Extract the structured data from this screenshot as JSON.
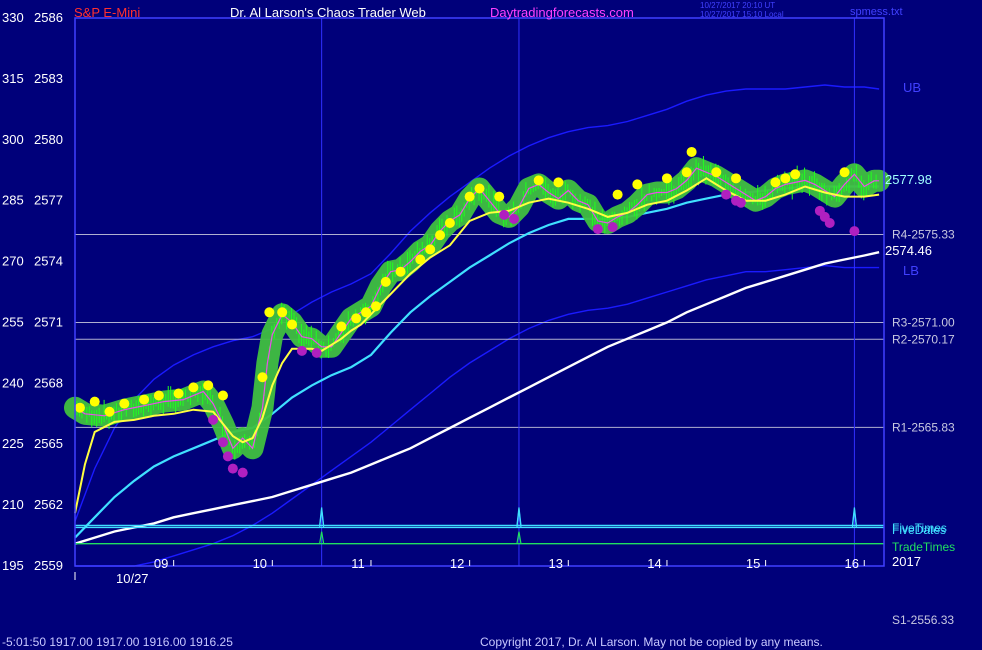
{
  "header": {
    "symbol": "S&P E-Mini",
    "title": "Dr. Al Larson's Chaos Trader Web",
    "site": "Daytradingforecasts.com",
    "stamp_utc": "10/27/2017 20:10 UT",
    "stamp_local": "10/27/2017 15:10 Local",
    "file_name": "spmess.txt"
  },
  "footer": {
    "readout": "-5:01:50  1917.00  1917.00  1916.00  1916.25",
    "copyright": "Copyright 2017, Dr. Al Larson. May not be copied by any means."
  },
  "colors": {
    "background": "#00007a",
    "frame": "#4040ff",
    "price_bars": "#20ff20",
    "fast_avg": "#ffff40",
    "mid_avg": "#40e0ff",
    "slow_avg": "#ffffff",
    "bands": "#1a1aff",
    "pivot_lines": "#b0b0d0",
    "highlight_halo": "#40c040",
    "up_marker": "#ffff00",
    "down_marker": "#b020c0"
  },
  "chart_data": {
    "type": "line",
    "y_left_ticks": [
      "330",
      "315",
      "300",
      "285",
      "270",
      "255",
      "240",
      "225",
      "210",
      "195"
    ],
    "y_price_ticks": [
      "2586",
      "2583",
      "2580",
      "2577",
      "2574",
      "2571",
      "2568",
      "2565",
      "2562",
      "2559"
    ],
    "ylim": [
      2559,
      2586
    ],
    "xlim": [
      8.0,
      16.2
    ],
    "x_ticks": [
      "09",
      "10",
      "11",
      "12",
      "13",
      "14",
      "15",
      "16"
    ],
    "date_label": "10/27",
    "vertical_markers": [
      10.5,
      12.5,
      15.9
    ],
    "pivots": [
      {
        "label": "R4-2575.33",
        "value": 2575.33
      },
      {
        "label": "R3-2571.00",
        "value": 2571.0
      },
      {
        "label": "R2-2570.17",
        "value": 2570.17
      },
      {
        "label": "R1-2565.83",
        "value": 2565.83
      },
      {
        "label": "S1-2556.33",
        "value": 2556.33
      }
    ],
    "last_price_label": "2577.98",
    "last_price": 2577.98,
    "slow_avg_label": "2574.46",
    "slow_avg_last": 2574.46,
    "band_labels": {
      "upper": "UB",
      "lower": "LB"
    },
    "time_rows": [
      {
        "name": "TradeTimes",
        "value": 2560.1,
        "label": "TradeTimes"
      },
      {
        "name": "FiveDates",
        "value": 2560.9,
        "label": "FiveDates"
      },
      {
        "name": "FiveTimes",
        "value": 2561.0,
        "label": "FiveTimes"
      }
    ],
    "year_label": "2017",
    "series": [
      {
        "name": "price",
        "x": [
          8.0,
          8.1,
          8.3,
          8.5,
          8.7,
          8.9,
          9.1,
          9.3,
          9.4,
          9.5,
          9.6,
          9.7,
          9.8,
          9.9,
          9.95,
          10.0,
          10.1,
          10.2,
          10.3,
          10.4,
          10.5,
          10.6,
          10.7,
          10.8,
          10.9,
          11.0,
          11.1,
          11.2,
          11.3,
          11.4,
          11.5,
          11.6,
          11.7,
          11.8,
          11.9,
          12.0,
          12.1,
          12.2,
          12.3,
          12.4,
          12.5,
          12.6,
          12.7,
          12.8,
          12.9,
          13.0,
          13.1,
          13.2,
          13.3,
          13.4,
          13.5,
          13.6,
          13.7,
          13.8,
          13.9,
          14.0,
          14.1,
          14.2,
          14.3,
          14.4,
          14.5,
          14.6,
          14.7,
          14.8,
          14.9,
          15.0,
          15.1,
          15.2,
          15.3,
          15.4,
          15.5,
          15.6,
          15.7,
          15.8,
          15.9,
          16.0,
          16.1,
          16.15
        ],
        "y": [
          2566.8,
          2566.5,
          2566.4,
          2566.7,
          2566.9,
          2567.1,
          2567.2,
          2567.6,
          2567.0,
          2566.0,
          2564.8,
          2565.3,
          2564.8,
          2566.8,
          2569.0,
          2570.4,
          2571.4,
          2571.0,
          2570.3,
          2570.2,
          2569.8,
          2569.8,
          2570.5,
          2571.2,
          2571.5,
          2571.8,
          2572.8,
          2573.5,
          2573.6,
          2574.0,
          2574.5,
          2574.8,
          2575.5,
          2576.0,
          2576.3,
          2577.1,
          2577.6,
          2577.0,
          2576.4,
          2576.2,
          2576.7,
          2577.6,
          2577.8,
          2577.4,
          2577.1,
          2577.5,
          2577.0,
          2576.8,
          2576.0,
          2575.9,
          2576.2,
          2576.4,
          2576.8,
          2577.3,
          2577.4,
          2577.4,
          2577.6,
          2578.0,
          2578.6,
          2578.4,
          2578.2,
          2577.9,
          2577.6,
          2577.3,
          2577.0,
          2577.2,
          2577.6,
          2577.8,
          2577.9,
          2578.0,
          2577.8,
          2577.5,
          2577.2,
          2577.8,
          2578.3,
          2577.7,
          2577.98,
          2577.98
        ]
      },
      {
        "name": "fast_avg",
        "x": [
          8.0,
          8.1,
          8.2,
          8.4,
          8.6,
          8.8,
          9.0,
          9.2,
          9.4,
          9.5,
          9.6,
          9.7,
          9.8,
          9.9,
          10.0,
          10.1,
          10.2,
          10.3,
          10.4,
          10.5,
          10.6,
          10.7,
          10.8,
          10.9,
          11.0,
          11.2,
          11.4,
          11.6,
          11.8,
          12.0,
          12.2,
          12.4,
          12.6,
          12.8,
          13.0,
          13.2,
          13.4,
          13.6,
          13.8,
          14.0,
          14.2,
          14.4,
          14.6,
          14.8,
          15.0,
          15.2,
          15.4,
          15.6,
          15.8,
          16.0,
          16.15
        ],
        "y": [
          2561.6,
          2564.0,
          2565.6,
          2566.1,
          2566.2,
          2566.4,
          2566.5,
          2566.7,
          2566.6,
          2566.0,
          2565.4,
          2565.1,
          2565.3,
          2566.3,
          2567.9,
          2569.0,
          2569.7,
          2569.7,
          2569.7,
          2569.6,
          2569.9,
          2570.2,
          2570.6,
          2570.9,
          2571.4,
          2572.4,
          2573.4,
          2574.2,
          2574.8,
          2576.0,
          2576.4,
          2576.5,
          2576.9,
          2577.1,
          2576.9,
          2576.6,
          2576.2,
          2576.4,
          2576.8,
          2577.0,
          2577.5,
          2578.1,
          2577.5,
          2577.0,
          2577.0,
          2577.3,
          2577.7,
          2577.4,
          2577.2,
          2577.2,
          2577.3
        ]
      },
      {
        "name": "mid_avg",
        "x": [
          8.0,
          8.2,
          8.4,
          8.6,
          8.8,
          9.0,
          9.2,
          9.4,
          9.6,
          9.8,
          10.0,
          10.2,
          10.4,
          10.6,
          10.8,
          11.0,
          11.2,
          11.4,
          11.6,
          11.8,
          12.0,
          12.2,
          12.4,
          12.6,
          12.8,
          13.0,
          13.2,
          13.4,
          13.6,
          13.8,
          14.0,
          14.2,
          14.4,
          14.6,
          14.8,
          15.0,
          15.2,
          15.4,
          15.6,
          15.8,
          16.0,
          16.15
        ],
        "y": [
          2560.4,
          2561.4,
          2562.4,
          2563.2,
          2563.9,
          2564.4,
          2564.8,
          2565.2,
          2565.6,
          2565.8,
          2566.5,
          2567.3,
          2567.9,
          2568.4,
          2568.8,
          2569.4,
          2570.5,
          2571.5,
          2572.3,
          2573.0,
          2573.7,
          2574.3,
          2574.9,
          2575.4,
          2575.8,
          2576.1,
          2576.1,
          2576.1,
          2576.2,
          2576.4,
          2576.6,
          2576.9,
          2577.1,
          2577.3,
          2577.4,
          2577.5,
          2577.6,
          2577.7,
          2577.7,
          2577.7,
          2577.7,
          2577.7
        ]
      },
      {
        "name": "slow_avg",
        "x": [
          8.0,
          8.2,
          8.4,
          8.6,
          8.8,
          9.0,
          9.2,
          9.4,
          9.6,
          9.8,
          10.0,
          10.2,
          10.4,
          10.6,
          10.8,
          11.0,
          11.2,
          11.4,
          11.6,
          11.8,
          12.0,
          12.2,
          12.4,
          12.6,
          12.8,
          13.0,
          13.2,
          13.4,
          13.6,
          13.8,
          14.0,
          14.2,
          14.4,
          14.6,
          14.8,
          15.0,
          15.2,
          15.4,
          15.6,
          15.8,
          16.0,
          16.15
        ],
        "y": [
          2560.1,
          2560.4,
          2560.7,
          2560.9,
          2561.1,
          2561.4,
          2561.6,
          2561.8,
          2562.0,
          2562.2,
          2562.4,
          2562.7,
          2563.0,
          2563.3,
          2563.6,
          2564.0,
          2564.4,
          2564.8,
          2565.3,
          2565.8,
          2566.3,
          2566.8,
          2567.3,
          2567.8,
          2568.3,
          2568.8,
          2569.3,
          2569.8,
          2570.2,
          2570.6,
          2571.0,
          2571.5,
          2571.9,
          2572.3,
          2572.7,
          2573.0,
          2573.3,
          2573.6,
          2573.9,
          2574.1,
          2574.3,
          2574.46
        ]
      },
      {
        "name": "upper_band",
        "x": [
          8.0,
          8.2,
          8.4,
          8.6,
          8.8,
          9.0,
          9.2,
          9.4,
          9.6,
          9.8,
          10.0,
          10.2,
          10.4,
          10.6,
          10.8,
          11.0,
          11.2,
          11.4,
          11.6,
          11.8,
          12.0,
          12.2,
          12.4,
          12.6,
          12.8,
          13.0,
          13.2,
          13.4,
          13.6,
          13.8,
          14.0,
          14.2,
          14.4,
          14.6,
          14.8,
          15.0,
          15.2,
          15.4,
          15.6,
          15.8,
          16.0,
          16.15
        ],
        "y": [
          2561.2,
          2563.8,
          2565.8,
          2567.2,
          2568.2,
          2568.9,
          2569.4,
          2569.8,
          2570.1,
          2570.3,
          2570.7,
          2571.4,
          2572.0,
          2572.5,
          2572.9,
          2573.4,
          2574.4,
          2575.5,
          2576.4,
          2577.2,
          2577.9,
          2578.6,
          2579.2,
          2579.7,
          2580.1,
          2580.4,
          2580.6,
          2580.7,
          2580.9,
          2581.2,
          2581.5,
          2581.9,
          2582.2,
          2582.4,
          2582.5,
          2582.5,
          2582.5,
          2582.6,
          2582.7,
          2582.6,
          2582.6,
          2582.5
        ]
      },
      {
        "name": "lower_band",
        "x": [
          8.0,
          8.2,
          8.4,
          8.6,
          8.8,
          9.0,
          9.2,
          9.4,
          9.6,
          9.8,
          10.0,
          10.2,
          10.4,
          10.6,
          10.8,
          11.0,
          11.2,
          11.4,
          11.6,
          11.8,
          12.0,
          12.2,
          12.4,
          12.6,
          12.8,
          13.0,
          13.2,
          13.4,
          13.6,
          13.8,
          14.0,
          14.2,
          14.4,
          14.6,
          14.8,
          15.0,
          15.2,
          15.4,
          15.6,
          15.8,
          16.0,
          16.15
        ],
        "y": [
          2559.0,
          2559.0,
          2559.0,
          2559.0,
          2559.2,
          2559.5,
          2559.8,
          2560.1,
          2560.5,
          2561.0,
          2561.6,
          2562.3,
          2563.0,
          2563.7,
          2564.4,
          2565.1,
          2565.9,
          2566.7,
          2567.5,
          2568.3,
          2569.0,
          2569.6,
          2570.2,
          2570.7,
          2571.1,
          2571.4,
          2571.6,
          2571.7,
          2571.9,
          2572.2,
          2572.5,
          2572.8,
          2573.1,
          2573.3,
          2573.5,
          2573.5,
          2573.6,
          2573.7,
          2573.8,
          2573.7,
          2573.7,
          2573.7
        ]
      }
    ],
    "up_markers": {
      "x": [
        8.05,
        8.2,
        8.35,
        8.5,
        8.7,
        8.85,
        9.05,
        9.2,
        9.35,
        9.5,
        9.9,
        9.97,
        10.1,
        10.2,
        10.7,
        10.85,
        10.95,
        11.05,
        11.15,
        11.3,
        11.5,
        11.6,
        11.7,
        11.8,
        12.0,
        12.1,
        12.3,
        12.7,
        12.9,
        13.5,
        13.7,
        14.0,
        14.2,
        14.25,
        14.5,
        14.7,
        15.1,
        15.2,
        15.3,
        15.8
      ],
      "y": [
        2566.8,
        2567.1,
        2566.6,
        2567.0,
        2567.2,
        2567.4,
        2567.5,
        2567.8,
        2567.9,
        2567.4,
        2568.3,
        2571.5,
        2571.5,
        2570.9,
        2570.8,
        2571.2,
        2571.5,
        2571.8,
        2573.0,
        2573.5,
        2574.1,
        2574.6,
        2575.3,
        2575.9,
        2577.2,
        2577.6,
        2577.2,
        2578.0,
        2577.9,
        2577.3,
        2577.8,
        2578.1,
        2578.4,
        2579.4,
        2578.4,
        2578.1,
        2577.9,
        2578.1,
        2578.3,
        2578.4
      ]
    },
    "down_markers": {
      "x": [
        9.4,
        9.5,
        9.55,
        9.6,
        9.7,
        10.3,
        10.45,
        12.35,
        12.45,
        13.3,
        13.45,
        14.6,
        14.7,
        14.75,
        15.55,
        15.6,
        15.65,
        15.9
      ],
      "y": [
        2566.2,
        2565.1,
        2564.4,
        2563.8,
        2563.6,
        2569.6,
        2569.5,
        2576.3,
        2576.1,
        2575.6,
        2575.7,
        2577.3,
        2577.0,
        2576.9,
        2576.5,
        2576.2,
        2575.9,
        2575.5
      ]
    }
  }
}
